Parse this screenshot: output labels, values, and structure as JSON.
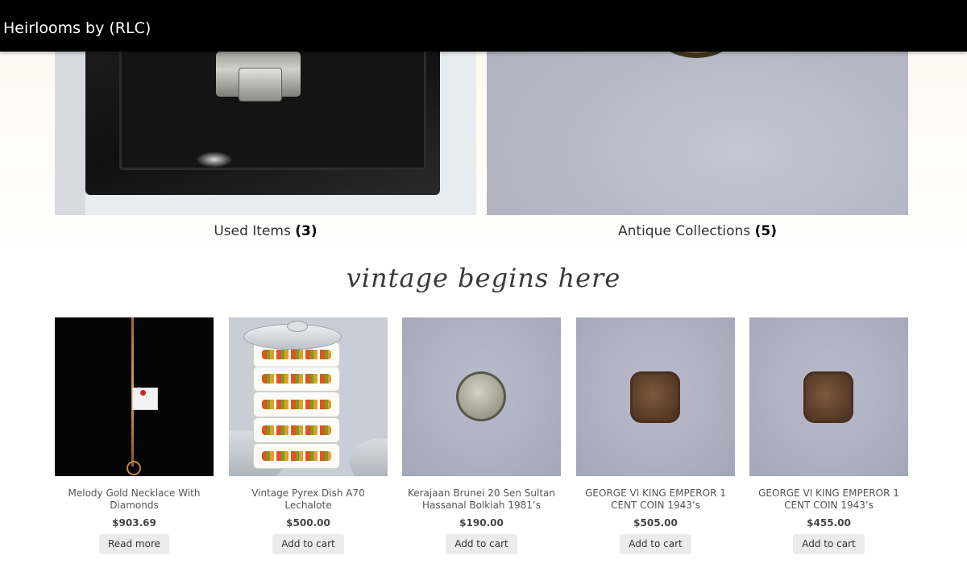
{
  "header": {
    "site_title": "Heirlooms by (RLC)"
  },
  "categories": [
    {
      "name": "Used Items",
      "count": "(3)",
      "image_icon": "wallet-photo"
    },
    {
      "name": "Antique Collections",
      "count": "(5)",
      "image_icon": "coin-photo"
    }
  ],
  "tagline": "vintage begins here",
  "products": [
    {
      "name": "Melody Gold Necklace With Diamonds",
      "price": "$903.69",
      "button": "Read more",
      "image_icon": "necklace-photo"
    },
    {
      "name": "Vintage Pyrex Dish A70 Lechalote",
      "price": "$500.00",
      "button": "Add to cart",
      "image_icon": "pyrex-dish-photo"
    },
    {
      "name": "Kerajaan Brunei 20 Sen Sultan Hassanal Bolkiah 1981’s",
      "price": "$190.00",
      "button": "Add to cart",
      "image_icon": "coin-photo"
    },
    {
      "name": "GEORGE VI KING EMPEROR 1 CENT COIN 1943’s",
      "price": "$505.00",
      "button": "Add to cart",
      "image_icon": "coin-photo"
    },
    {
      "name": "GEORGE VI KING EMPEROR 1 CENT COIN 1943’s",
      "price": "$455.00",
      "button": "Add to cart",
      "image_icon": "coin-photo"
    }
  ],
  "colors": {
    "header_bg": "#000000",
    "button_bg": "#ebebeb"
  }
}
